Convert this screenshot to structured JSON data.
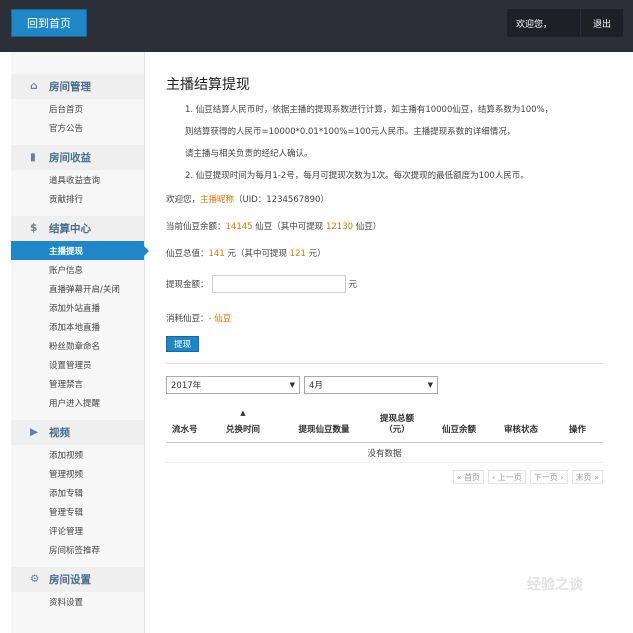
{
  "header": {
    "home_label": "回到首页",
    "welcome": "欢迎您，",
    "logout": "退出"
  },
  "sidebar": {
    "sections": [
      {
        "title": "房间管理",
        "icon": "home-icon",
        "items": [
          "后台首页",
          "官方公告"
        ]
      },
      {
        "title": "房间收益",
        "icon": "bar-chart-icon",
        "items": [
          "道具收益查询",
          "贡献排行"
        ]
      },
      {
        "title": "结算中心",
        "icon": "money-icon",
        "items": [
          "主播提现",
          "账户信息",
          "直播弹幕开启/关闭",
          "添加外站直播",
          "添加本地直播",
          "粉丝勋章命名",
          "设置管理员",
          "管理禁言",
          "用户进入提醒"
        ]
      },
      {
        "title": "视频",
        "icon": "video-icon",
        "items": [
          "添加视频",
          "管理视频",
          "添加专辑",
          "管理专辑",
          "评论管理",
          "房间标签推荐"
        ]
      },
      {
        "title": "房间设置",
        "icon": "gear-icon",
        "items": [
          "资料设置"
        ]
      }
    ],
    "active": "主播提现"
  },
  "main": {
    "title": "主播结算提现",
    "notes": [
      "1. 仙豆结算人民币时，依据主播的提现系数进行计算，如主播有10000仙豆，结算系数为100%，",
      "则结算获得的人民币=10000*0.01*100%=100元人民币。主播提现系数的详细情况，",
      "请主播与相关负责的经纪人确认。",
      "2. 仙豆提现时间为每月1-2号，每月可提现次数为1次。每次提现的最低额度为100人民币。"
    ],
    "welcome_prefix": "欢迎您，",
    "streamer_name": "主播昵称",
    "uid_text": "（UID：1234567890）",
    "balance_prefix": "当前仙豆余额：",
    "balance": "14145",
    "balance_mid": " 仙豆（其中可提现 ",
    "balance_withdrawable": "12130",
    "balance_suffix": " 仙豆）",
    "value_prefix": "仙豆总值：",
    "value": "141",
    "value_mid": " 元（其中可提现 ",
    "value_withdrawable": "121",
    "value_suffix": " 元）",
    "amount_label": "提现金额：",
    "amount_value": "",
    "amount_unit": "元",
    "consume_label": "消耗仙豆：",
    "consume_value": "- 仙豆",
    "submit_label": "提现",
    "year_select": "2017年",
    "month_select": "4月",
    "table_headers": [
      "流水号",
      "兑换时间",
      "提现仙豆数量",
      "提现总额\n（元）",
      "仙豆余额",
      "审核状态",
      "操作"
    ],
    "empty_text": "没有数据",
    "pager": [
      "« 首页",
      "‹ 上一页",
      "下一页 ›",
      "末页 »"
    ]
  },
  "watermark": "经验之谈"
}
